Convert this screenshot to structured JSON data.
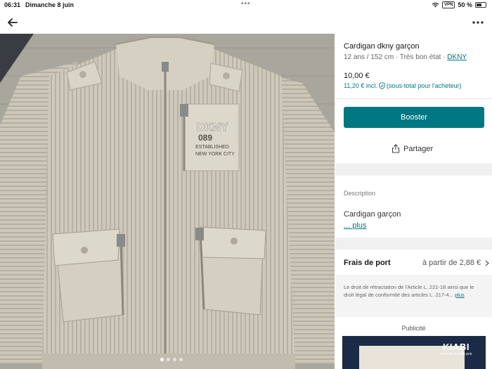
{
  "status_bar": {
    "time": "06:31",
    "date": "Dimanche 8 juin",
    "vpn": "VPN",
    "battery": "50 %"
  },
  "nav": {
    "back_icon": "arrow-left-icon",
    "more_icon": "more-horizontal-icon"
  },
  "photo": {
    "alt": "Cardigan dkny garçon",
    "print_lines": [
      "DKNY",
      "089",
      "ESTABLISHED",
      "NEW YORK CITY"
    ],
    "pager_count": 4,
    "pager_active": 0
  },
  "item": {
    "title": "Cardigan dkny garçon",
    "details": "12 ans / 152 cm · Très bon état · ",
    "brand": "DKNY",
    "price": "10,00 €",
    "price_incl": "11,20 € incl.",
    "price_incl_note": "(sous-total pour l'acheteur)"
  },
  "actions": {
    "booster_label": "Booster",
    "share_label": "Partager"
  },
  "description": {
    "heading": "Description",
    "text": "Cardigan garçon",
    "more_label": "... plus"
  },
  "shipping": {
    "label": "Frais de port",
    "value": "à partir de 2,88 €"
  },
  "legal": {
    "text": "Le droit de rétractation de l'Article L. 221-18 ainsi que le droit légal de conformité des articles L. 217-4...",
    "more_label": "plus"
  },
  "ad": {
    "heading": "Publicité",
    "brand": "KIABI",
    "tagline": "la mode à petits prix"
  },
  "colors": {
    "accent": "#007782",
    "background": "#ffffff",
    "divider": "#e6e6e6"
  }
}
